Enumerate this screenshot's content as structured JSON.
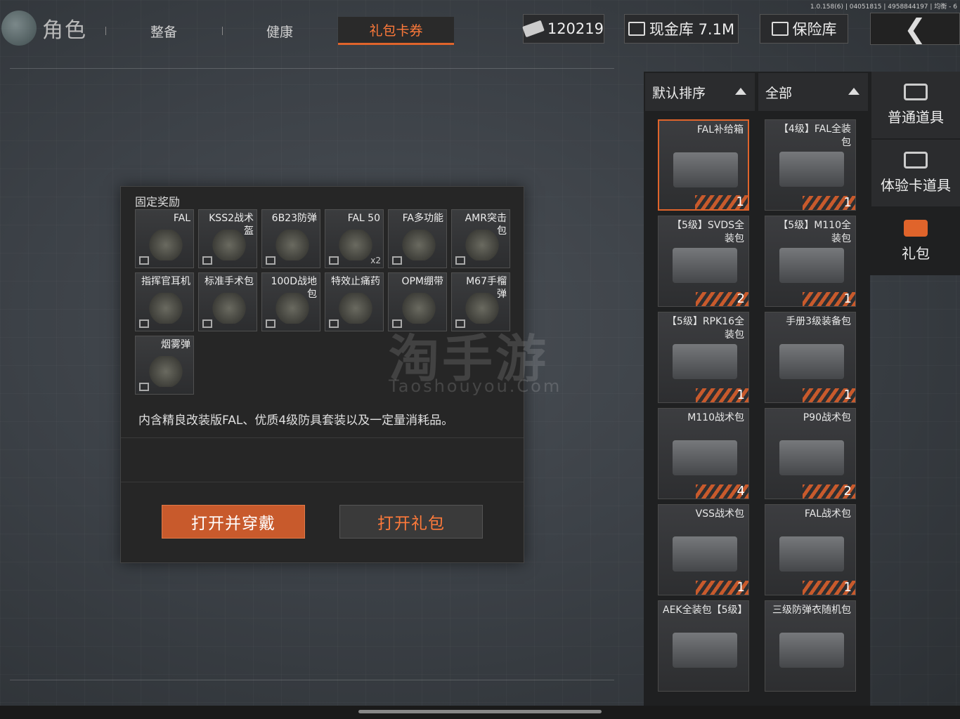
{
  "version_text": "1.0.158(6) | 04051815 | 4958844197 | 均衡 - 6",
  "header": {
    "title": "角色",
    "tabs": [
      {
        "label": "整备"
      },
      {
        "label": "健康"
      },
      {
        "label": "礼包卡券",
        "active": true
      }
    ],
    "currency_value": "120219",
    "cash_vault": "现金库 7.1M",
    "safe_box": "保险库",
    "back_icon": "chevron-left-icon"
  },
  "dialog": {
    "title": "固定奖励",
    "items": [
      {
        "name": "FAL",
        "qty": ""
      },
      {
        "name": "KSS2战术\n盔",
        "qty": ""
      },
      {
        "name": "6B23防弹",
        "qty": ""
      },
      {
        "name": "FAL 50",
        "qty": "x2"
      },
      {
        "name": "FA多功能",
        "qty": ""
      },
      {
        "name": "AMR突击\n包",
        "qty": ""
      },
      {
        "name": "指挥官耳机",
        "qty": ""
      },
      {
        "name": "标准手术包",
        "qty": ""
      },
      {
        "name": "100D战地\n包",
        "qty": ""
      },
      {
        "name": "特效止痛药",
        "qty": ""
      },
      {
        "name": "OPM绷带",
        "qty": ""
      },
      {
        "name": "M67手榴\n弹",
        "qty": ""
      },
      {
        "name": "烟雾弹",
        "qty": ""
      }
    ],
    "description": "内含精良改装版FAL、优质4级防具套装以及一定量消耗品。",
    "btn_open_wear": "打开并穿戴",
    "btn_open": "打开礼包"
  },
  "watermark": {
    "text": "淘手游",
    "sub": "Taoshouyou.Com"
  },
  "sort": {
    "label": "默认排序",
    "filter": "全部"
  },
  "inventory": [
    {
      "name": "FAL补给箱",
      "count": "1",
      "selected": true
    },
    {
      "name": "【4级】FAL全装包",
      "count": "1"
    },
    {
      "name": "【5级】SVDS全装包",
      "count": "2"
    },
    {
      "name": "【5级】M110全装包",
      "count": "1"
    },
    {
      "name": "【5级】RPK16全装包",
      "count": "1"
    },
    {
      "name": "手册3级装备包",
      "count": "1"
    },
    {
      "name": "M110战术包",
      "count": "4"
    },
    {
      "name": "P90战术包",
      "count": "2"
    },
    {
      "name": "VSS战术包",
      "count": "1"
    },
    {
      "name": "FAL战术包",
      "count": "1"
    },
    {
      "name": "AEK全装包【5级】",
      "count": ""
    },
    {
      "name": "三级防弹衣随机包",
      "count": ""
    }
  ],
  "categories": [
    {
      "label": "普通道具",
      "icon": "chest-icon"
    },
    {
      "label": "体验卡道具",
      "icon": "card-icon"
    },
    {
      "label": "礼包",
      "icon": "gift-icon",
      "active": true
    }
  ],
  "colors": {
    "accent": "#e0642b",
    "panel": "#1f2021"
  }
}
